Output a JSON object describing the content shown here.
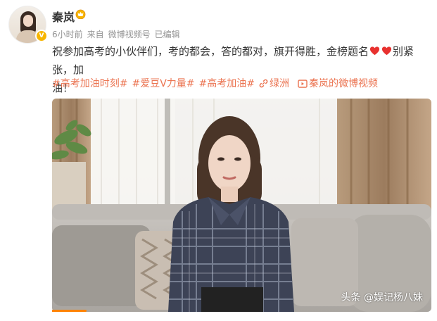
{
  "post": {
    "author": "秦岚",
    "time": "6小时前",
    "source_prefix": "来自",
    "source": "微博视频号",
    "edited": "已编辑",
    "text_line1": "祝参加高考的小伙伴们，考的都会，答的都对，旗开得胜，金榜题名",
    "text_after_hearts": "别紧张，加",
    "text_line2": "油！",
    "tags": {
      "tag1": "#高考加油时刻#",
      "tag2": "#爱豆V力量#",
      "tag3": "#高考加油#",
      "link_location": "绿洲",
      "link_video": "秦岚的微博视频"
    },
    "video_progress": 0.09
  },
  "watermark": "头条 @娱记杨八妹",
  "colors": {
    "link": "#eb7350",
    "progress": "#ff8200",
    "heart": "#e8312f",
    "meta": "#939393"
  },
  "icons": {
    "vip_badge": "vip-crown-icon",
    "verified_badge": "verified-v-icon",
    "heart": "red-heart-icon",
    "link": "link-icon",
    "video": "video-icon"
  }
}
